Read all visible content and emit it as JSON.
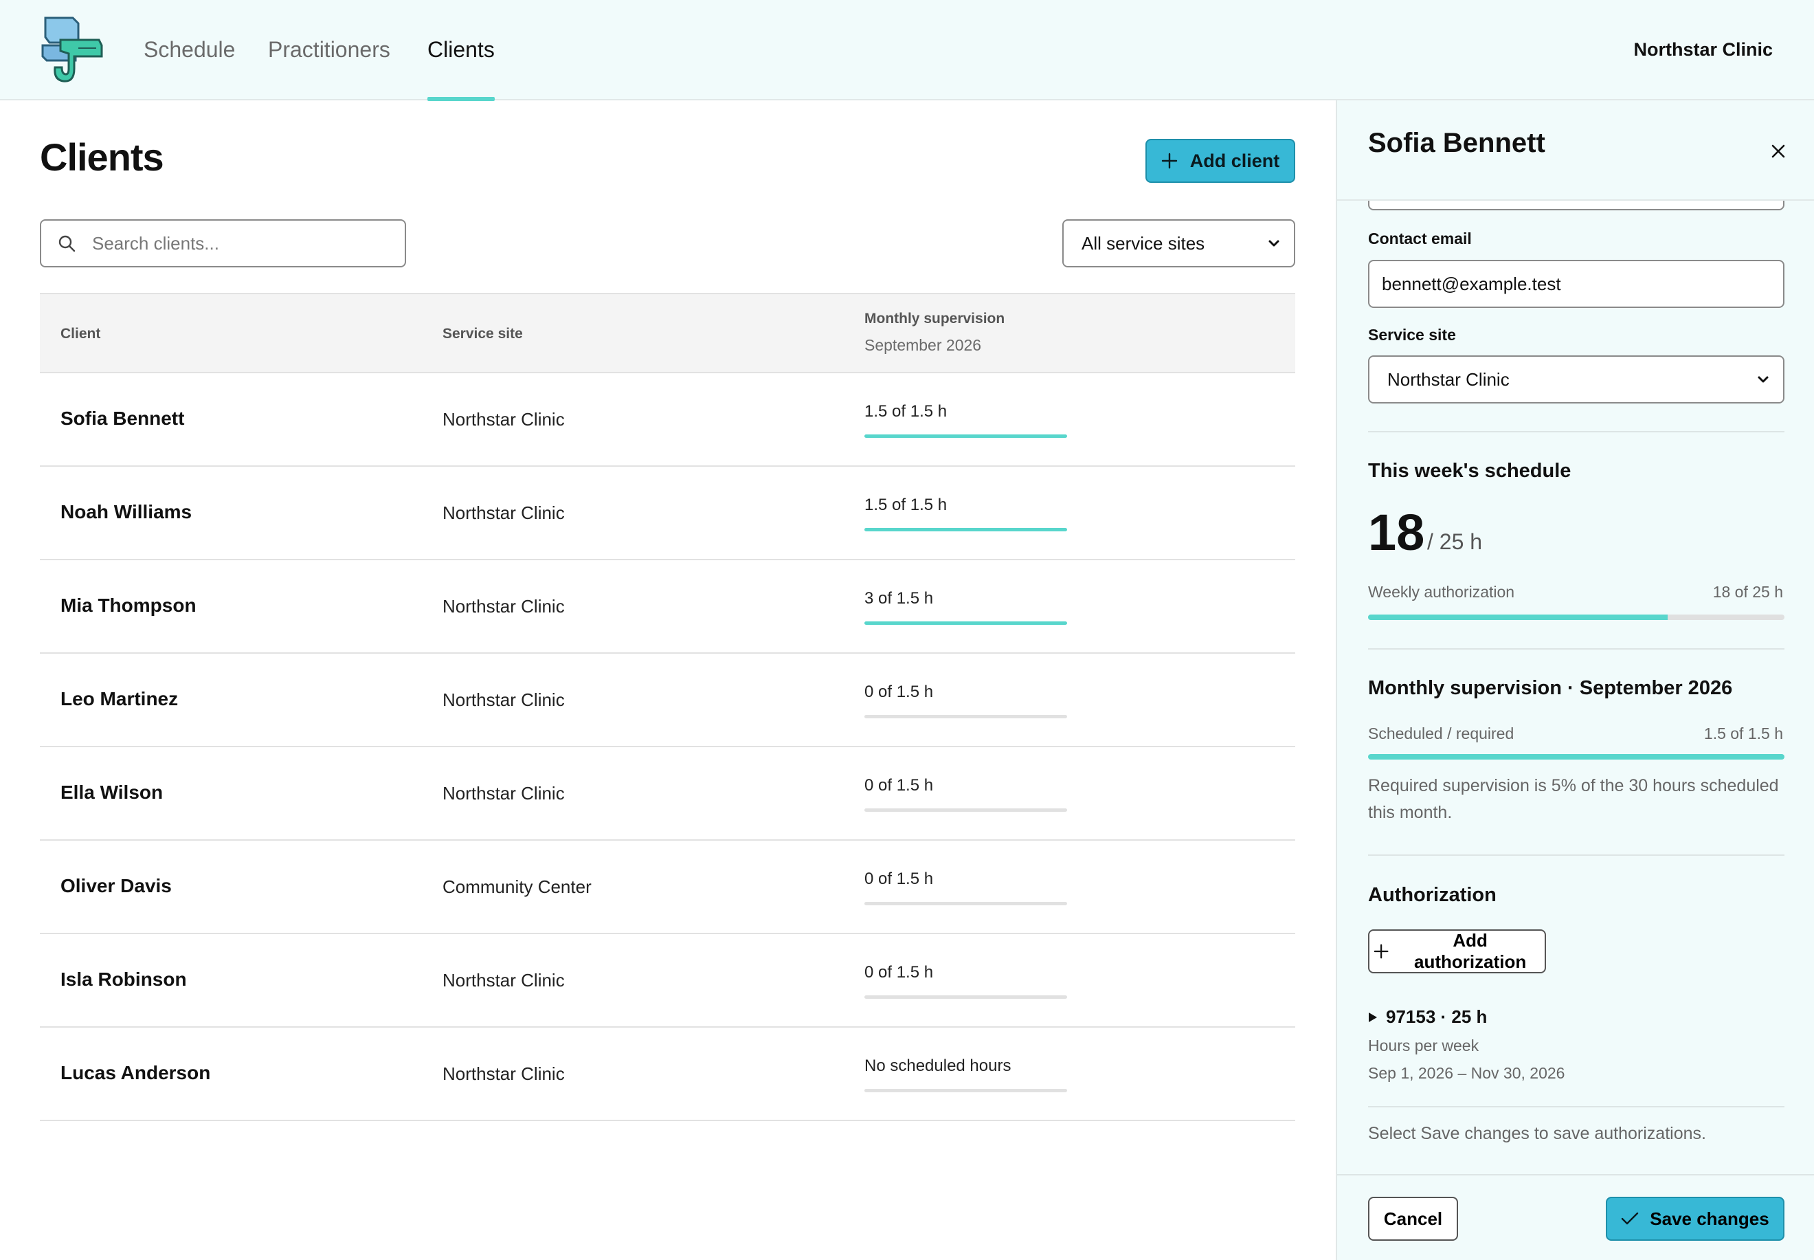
{
  "nav": {
    "tabs": [
      {
        "label": "Schedule"
      },
      {
        "label": "Practitioners"
      },
      {
        "label": "Clients",
        "active": true
      }
    ],
    "org_name": "Northstar Clinic"
  },
  "main": {
    "title": "Clients",
    "add_client_label": "Add client",
    "search_placeholder": "Search clients...",
    "site_filter_value": "All service sites",
    "table": {
      "headers": {
        "client": "Client",
        "service_site": "Service site",
        "monthly_supervision": "Monthly supervision",
        "month": "September 2026"
      },
      "rows": [
        {
          "client": "Sofia Bennett",
          "site": "Northstar Clinic",
          "supervision": "1.5 of 1.5 h",
          "progress": 1.0
        },
        {
          "client": "Noah Williams",
          "site": "Northstar Clinic",
          "supervision": "1.5 of 1.5 h",
          "progress": 1.0
        },
        {
          "client": "Mia Thompson",
          "site": "Northstar Clinic",
          "supervision": "3 of 1.5 h",
          "progress": 1.0
        },
        {
          "client": "Leo Martinez",
          "site": "Northstar Clinic",
          "supervision": "0 of 1.5 h",
          "progress": 0.0
        },
        {
          "client": "Ella Wilson",
          "site": "Northstar Clinic",
          "supervision": "0 of 1.5 h",
          "progress": 0.0
        },
        {
          "client": "Oliver Davis",
          "site": "Community Center",
          "supervision": "0 of 1.5 h",
          "progress": 0.0
        },
        {
          "client": "Isla Robinson",
          "site": "Northstar Clinic",
          "supervision": "0 of 1.5 h",
          "progress": 0.0
        },
        {
          "client": "Lucas Anderson",
          "site": "Northstar Clinic",
          "supervision": "No scheduled hours",
          "progress": 0.0
        }
      ]
    }
  },
  "panel": {
    "title": "Sofia Bennett",
    "contact_email_label": "Contact email",
    "contact_email_value": "bennett@example.test",
    "service_site_label": "Service site",
    "service_site_value": "Northstar Clinic",
    "week": {
      "heading": "This week's schedule",
      "hours": "18",
      "total": "/ 25 h",
      "label": "Weekly authorization",
      "value": "18 of 25 h",
      "progress": 0.72
    },
    "supervision": {
      "heading": "Monthly supervision · September 2026",
      "label": "Scheduled / required",
      "value": "1.5 of 1.5 h",
      "progress": 1.0,
      "note": "Required supervision is 5% of the 30 hours scheduled this month."
    },
    "authorization": {
      "heading": "Authorization",
      "add_label": "Add authorization",
      "item_summary": "97153 · 25 h",
      "item_unit": "Hours per week",
      "item_range": "Sep 1, 2026 – Nov 30, 2026",
      "save_note": "Select Save changes to save authorizations."
    },
    "cancel_label": "Cancel",
    "save_label": "Save changes"
  },
  "colors": {
    "accent": "#58d6cc",
    "primary_button": "#37b8d6",
    "panel_bg": "#f1fbfb"
  }
}
